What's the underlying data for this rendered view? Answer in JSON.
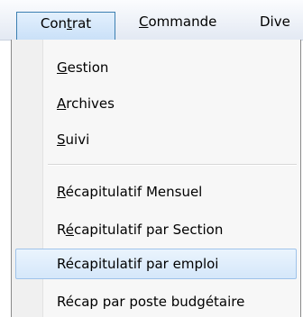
{
  "menubar": {
    "items": [
      {
        "pre": "Con",
        "ul": "t",
        "post": "rat"
      },
      {
        "pre": "",
        "ul": "C",
        "post": "ommande"
      },
      {
        "pre": "Dive",
        "ul": "",
        "post": ""
      }
    ]
  },
  "menu": {
    "items": [
      {
        "pre": "",
        "ul": "G",
        "post": "estion"
      },
      {
        "pre": "",
        "ul": "A",
        "post": "rchives"
      },
      {
        "pre": "",
        "ul": "S",
        "post": "uivi"
      },
      {
        "pre": "",
        "ul": "R",
        "post": "écapitulatif Mensuel"
      },
      {
        "pre": "R",
        "ul": "é",
        "post": "capitulatif par Section"
      },
      {
        "pre": "Récapitulatif par emploi",
        "ul": "",
        "post": ""
      },
      {
        "pre": "Récap par poste budgétaire",
        "ul": "",
        "post": ""
      }
    ]
  }
}
